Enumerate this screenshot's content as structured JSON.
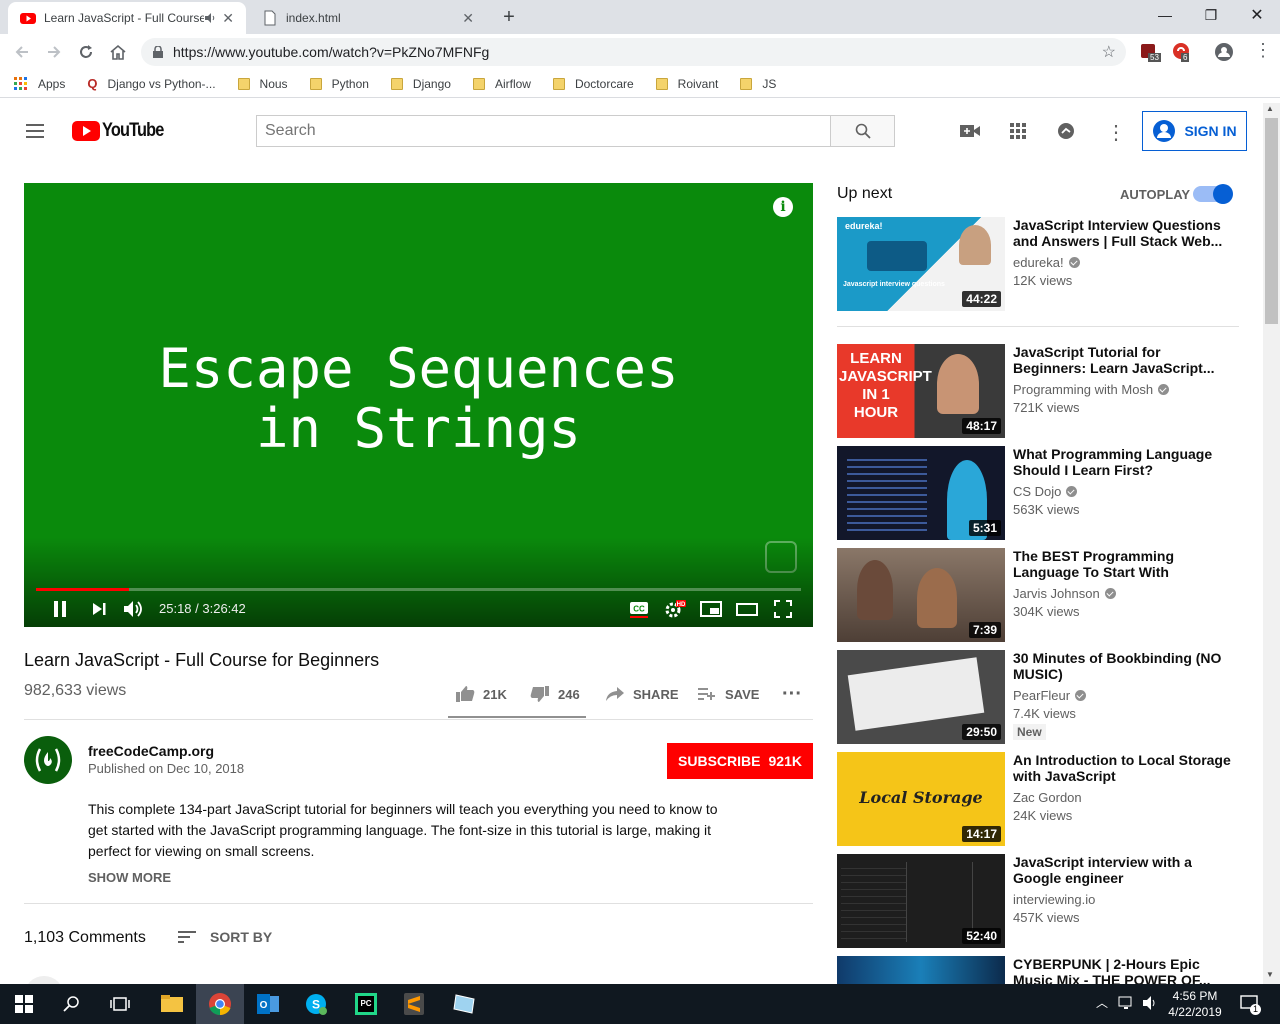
{
  "browser": {
    "tabs": [
      {
        "title": "Learn JavaScript - Full Course",
        "favicon": "youtube-icon"
      },
      {
        "title": "index.html",
        "favicon": "file-icon"
      }
    ],
    "url": "https://www.youtube.com/watch?v=PkZNo7MFNFg",
    "extension_badges": [
      "53",
      "6"
    ],
    "bookmarks": [
      "Apps",
      "Django vs Python-...",
      "Nous",
      "Python",
      "Django",
      "Airflow",
      "Doctorcare",
      "Roivant",
      "JS"
    ]
  },
  "youtube": {
    "logo_text": "YouTube",
    "search_placeholder": "Search",
    "sign_in": "SIGN IN"
  },
  "player": {
    "title_line1": "Escape Sequences",
    "title_line2": "in Strings",
    "time": "25:18 / 3:26:42",
    "progress_fraction": 0.122,
    "background_color": "#0a8a0c"
  },
  "video": {
    "title": "Learn JavaScript - Full Course for Beginners",
    "views": "982,633 views",
    "likes": "21K",
    "dislikes": "246",
    "share": "SHARE",
    "save": "SAVE",
    "channel": "freeCodeCamp.org",
    "published": "Published on Dec 10, 2018",
    "subscribe": "SUBSCRIBE",
    "subscribers": "921K",
    "description": "This complete 134-part JavaScript tutorial for beginners will teach you everything you need to know to get started with the JavaScript programming language. The font-size in this tutorial is large, making it perfect for viewing on small screens.",
    "show_more": "SHOW MORE",
    "comments_count": "1,103 Comments",
    "sort_by": "SORT BY"
  },
  "upnext": {
    "heading": "Up next",
    "autoplay_label": "AUTOPLAY",
    "autoplay_on": true,
    "items": [
      {
        "title": "JavaScript Interview Questions and Answers | Full Stack Web...",
        "channel": "edureka!",
        "views": "12K views",
        "duration": "44:22",
        "verified": true,
        "thumb_text": "edureka!",
        "thumb_sub": "Javascript interview questions"
      },
      {
        "title": "JavaScript Tutorial for Beginners: Learn JavaScript...",
        "channel": "Programming with Mosh",
        "views": "721K views",
        "duration": "48:17",
        "verified": true,
        "thumb_text": "LEARN JAVASCRIPT IN 1 HOUR"
      },
      {
        "title": "What Programming Language Should I Learn First?",
        "channel": "CS Dojo",
        "views": "563K views",
        "duration": "5:31",
        "verified": true
      },
      {
        "title": "The BEST Programming Language To Start With",
        "channel": "Jarvis Johnson",
        "views": "304K views",
        "duration": "7:39",
        "verified": true
      },
      {
        "title": "30 Minutes of Bookbinding (NO MUSIC)",
        "channel": "PearFleur",
        "views": "7.4K views",
        "duration": "29:50",
        "verified": true,
        "badge": "New"
      },
      {
        "title": "An Introduction to Local Storage with JavaScript",
        "channel": "Zac Gordon",
        "views": "24K views",
        "duration": "14:17",
        "verified": false,
        "thumb_text": "Local Storage"
      },
      {
        "title": "JavaScript interview with a Google engineer",
        "channel": "interviewing.io",
        "views": "457K views",
        "duration": "52:40",
        "verified": false
      },
      {
        "title": "CYBERPUNK | 2-Hours Epic Music Mix - THE POWER OF...",
        "channel": "",
        "views": "",
        "duration": "",
        "verified": false
      }
    ]
  },
  "taskbar": {
    "time": "4:56 PM",
    "date": "4/22/2019",
    "notification_count": "1"
  }
}
